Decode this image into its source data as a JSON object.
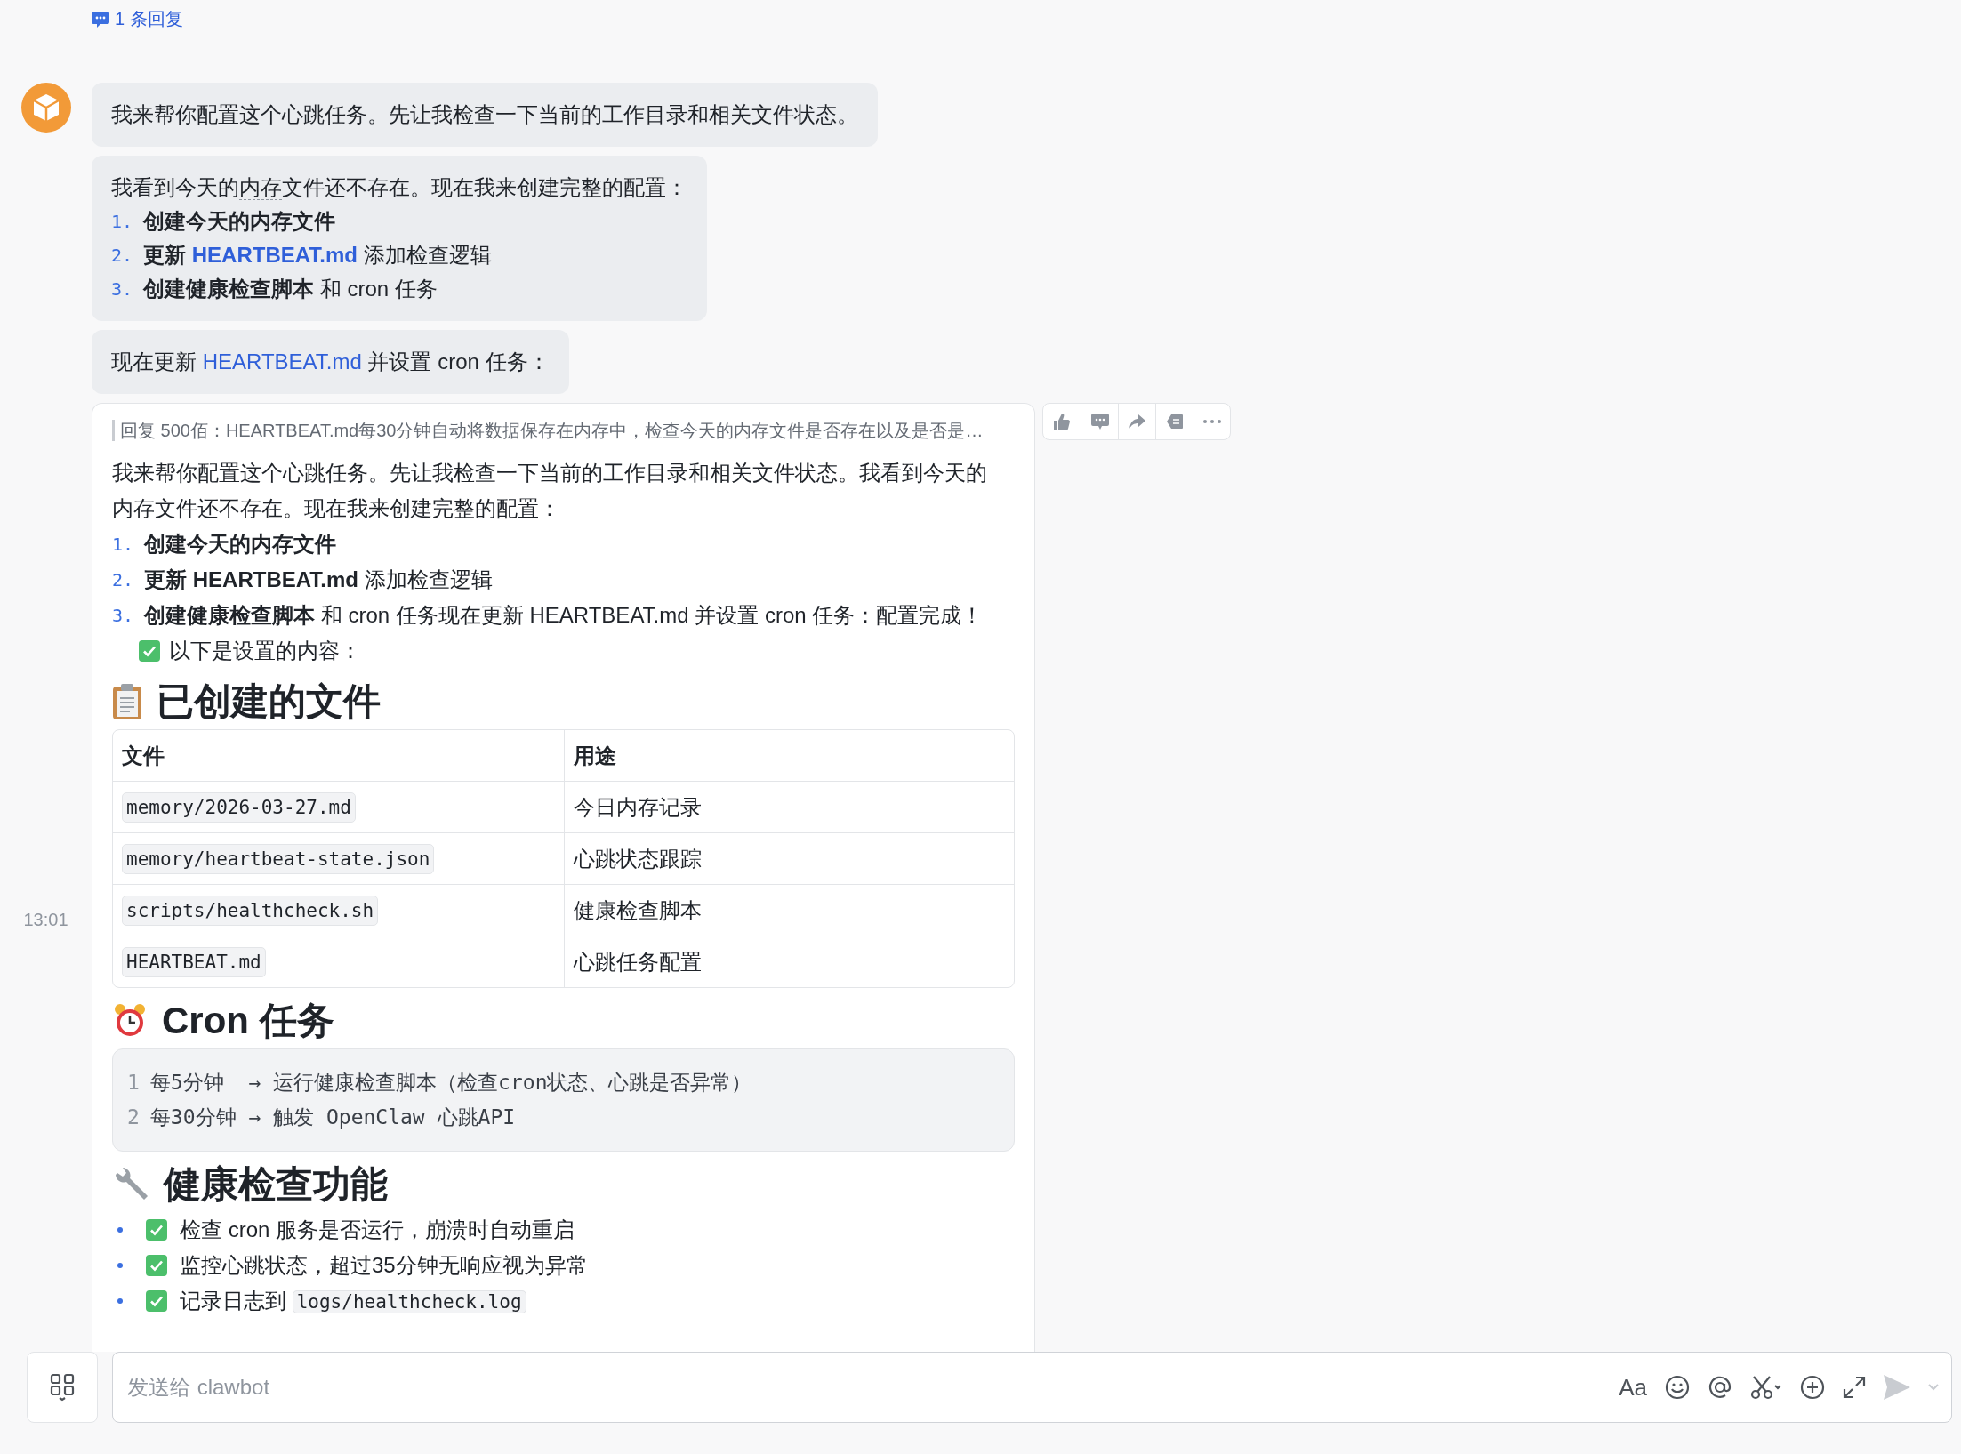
{
  "thread_reply": {
    "label": "1 条回复"
  },
  "bubbles": [
    {
      "intro": [
        {
          "kind": "plain",
          "text": "我来帮你配置这个心跳任务。先让我检查一下当前的工作目录和相关文件状态。"
        }
      ]
    },
    {
      "intro": [
        {
          "kind": "plain",
          "text": "我看到今天的"
        },
        {
          "kind": "term",
          "text": "内存"
        },
        {
          "kind": "plain",
          "text": "文件还不存在。现在我来创建完整的配置："
        }
      ],
      "list": [
        {
          "number": "1.",
          "segments": [
            {
              "kind": "bold",
              "text": "创建今天的内存文件"
            }
          ]
        },
        {
          "number": "2.",
          "segments": [
            {
              "kind": "bold",
              "text": "更新 "
            },
            {
              "kind": "boldlink",
              "text": "HEARTBEAT.md"
            },
            {
              "kind": "plain",
              "text": " 添加检查逻辑"
            }
          ]
        },
        {
          "number": "3.",
          "segments": [
            {
              "kind": "bold",
              "text": "创建健康检查脚本"
            },
            {
              "kind": "plain",
              "text": " 和 "
            },
            {
              "kind": "term",
              "text": "cron"
            },
            {
              "kind": "plain",
              "text": " 任务"
            }
          ]
        }
      ]
    },
    {
      "intro": [
        {
          "kind": "plain",
          "text": "现在更新 "
        },
        {
          "kind": "link",
          "text": "HEARTBEAT.md"
        },
        {
          "kind": "plain",
          "text": " 并设置 "
        },
        {
          "kind": "term",
          "text": "cron"
        },
        {
          "kind": "plain",
          "text": " 任务："
        }
      ]
    }
  ],
  "card": {
    "quote": "回复 500佰：HEARTBEAT.md每30分钟自动将数据保存在内存中，检查今天的内存文件是否存在以及是否是…",
    "intro": "我来帮你配置这个心跳任务。先让我检查一下当前的工作目录和相关文件状态。我看到今天的内存文件还不存在。现在我来创建完整的配置：",
    "list": [
      {
        "number": "1.",
        "segments": [
          {
            "kind": "bold",
            "text": "创建今天的内存文件"
          }
        ]
      },
      {
        "number": "2.",
        "segments": [
          {
            "kind": "bold",
            "text": "更新 HEARTBEAT.md"
          },
          {
            "kind": "plain",
            "text": " 添加检查逻辑"
          }
        ]
      },
      {
        "number": "3.",
        "segments": [
          {
            "kind": "bold",
            "text": "创建健康检查脚本"
          },
          {
            "kind": "plain",
            "text": " 和 cron 任务现在更新 HEARTBEAT.md 并设置 cron 任务：配置完成！"
          }
        ]
      }
    ],
    "check_line": "以下是设置的内容：",
    "sections": [
      {
        "kind": "table",
        "title": "已创建的文件",
        "columns": [
          "文件",
          "用途"
        ],
        "rows": [
          [
            "memory/2026-03-27.md",
            "今日内存记录"
          ],
          [
            "memory/heartbeat-state.json",
            "心跳状态跟踪"
          ],
          [
            "scripts/healthcheck.sh",
            "健康检查脚本"
          ],
          [
            "HEARTBEAT.md",
            "心跳任务配置"
          ]
        ]
      },
      {
        "kind": "code",
        "title": "Cron 任务",
        "lines": [
          {
            "number": "1",
            "text": "每5分钟  → 运行健康检查脚本（检查cron状态、心跳是否异常）"
          },
          {
            "number": "2",
            "text": "每30分钟 → 触发 OpenClaw 心跳API"
          }
        ]
      },
      {
        "kind": "checklist",
        "title": "健康检查功能",
        "items": [
          [
            {
              "kind": "plain",
              "text": "检查 cron 服务是否运行，崩溃时自动重启"
            }
          ],
          [
            {
              "kind": "plain",
              "text": "监控心跳状态，超过35分钟无响应视为异常"
            }
          ],
          [
            {
              "kind": "plain",
              "text": "记录日志到 "
            },
            {
              "kind": "code",
              "text": "logs/healthcheck.log"
            }
          ]
        ]
      }
    ]
  },
  "timestamp": "13:01",
  "composer": {
    "placeholder": "发送给 clawbot",
    "format_label": "Aa"
  }
}
